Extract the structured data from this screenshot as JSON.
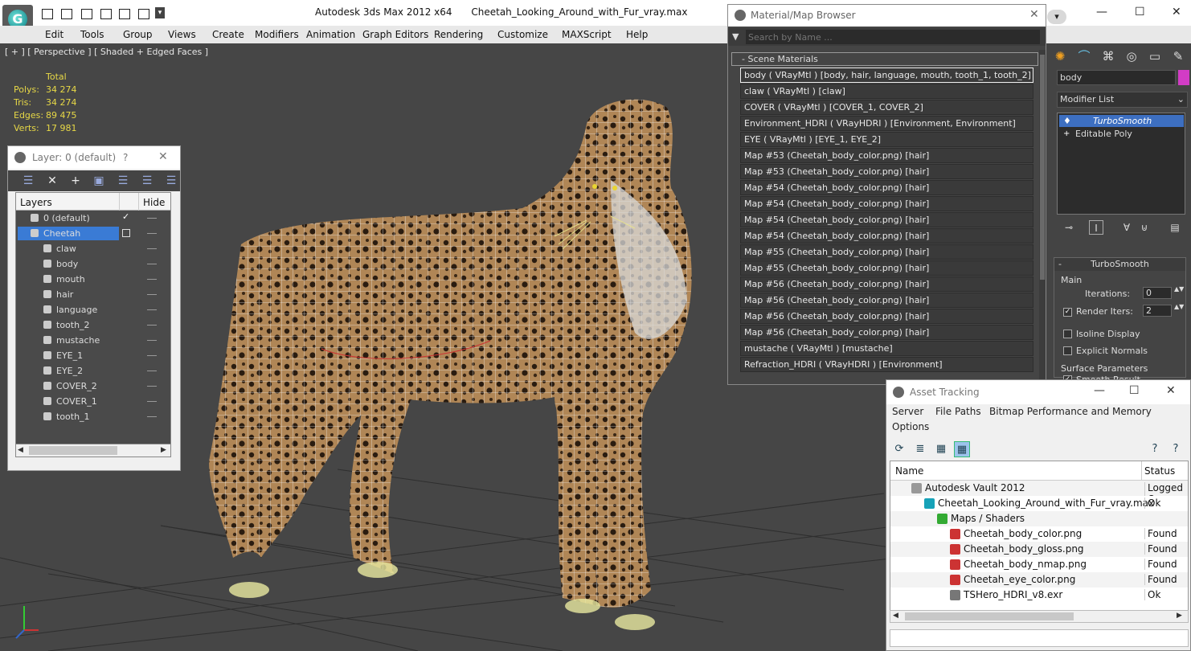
{
  "title_bar": {
    "app_title": "Autodesk 3ds Max  2012 x64",
    "file_name": "Cheetah_Looking_Around_with_Fur_vray.max"
  },
  "menu": [
    "Edit",
    "Tools",
    "Group",
    "Views",
    "Create",
    "Modifiers",
    "Animation",
    "Graph Editors",
    "Rendering",
    "Customize",
    "MAXScript",
    "Help"
  ],
  "viewport": {
    "label": "[ + ] [ Perspective ] [ Shaded + Edged Faces ]",
    "stats": {
      "header": "Total",
      "rows": [
        {
          "label": "Polys:",
          "value": "34 274"
        },
        {
          "label": "Tris:",
          "value": "34 274"
        },
        {
          "label": "Edges:",
          "value": "89 475"
        },
        {
          "label": "Verts:",
          "value": "17 981"
        }
      ]
    }
  },
  "layer_dialog": {
    "title": "Layer: 0 (default)",
    "help": "?",
    "columns": {
      "layers": "Layers",
      "hide": "Hide"
    },
    "rows": [
      {
        "name": "0 (default)",
        "level": 1,
        "current": true
      },
      {
        "name": "Cheetah",
        "level": 1,
        "selected": true
      },
      {
        "name": "claw",
        "level": 2
      },
      {
        "name": "body",
        "level": 2
      },
      {
        "name": "mouth",
        "level": 2
      },
      {
        "name": "hair",
        "level": 2
      },
      {
        "name": "language",
        "level": 2
      },
      {
        "name": "tooth_2",
        "level": 2
      },
      {
        "name": "mustache",
        "level": 2
      },
      {
        "name": "EYE_1",
        "level": 2
      },
      {
        "name": "EYE_2",
        "level": 2
      },
      {
        "name": "COVER_2",
        "level": 2
      },
      {
        "name": "COVER_1",
        "level": 2
      },
      {
        "name": "tooth_1",
        "level": 2
      }
    ]
  },
  "material_browser": {
    "title": "Material/Map Browser",
    "search_placeholder": "Search by Name ...",
    "section": "- Scene Materials",
    "items": [
      "body  ( VRayMtl )  [body, hair, language, mouth, tooth_1, tooth_2]",
      "claw  ( VRayMtl )  [claw]",
      "COVER  ( VRayMtl )  [COVER_1, COVER_2]",
      "Environment_HDRI  ( VRayHDRI )  [Environment, Environment]",
      "EYE  ( VRayMtl )  [EYE_1, EYE_2]",
      "Map #53 (Cheetah_body_color.png)  [hair]",
      "Map #53 (Cheetah_body_color.png)  [hair]",
      "Map #54 (Cheetah_body_color.png)  [hair]",
      "Map #54 (Cheetah_body_color.png)  [hair]",
      "Map #54 (Cheetah_body_color.png)  [hair]",
      "Map #54 (Cheetah_body_color.png)  [hair]",
      "Map #55 (Cheetah_body_color.png)  [hair]",
      "Map #55 (Cheetah_body_color.png)  [hair]",
      "Map #56 (Cheetah_body_color.png)  [hair]",
      "Map #56 (Cheetah_body_color.png)  [hair]",
      "Map #56 (Cheetah_body_color.png)  [hair]",
      "Map #56 (Cheetah_body_color.png)  [hair]",
      "mustache  ( VRayMtl )  [mustache]",
      "Refraction_HDRI  ( VRayHDRI )  [Environment]"
    ]
  },
  "command_panel": {
    "object_name": "body",
    "object_color": "#d23cc5",
    "modifier_list": "Modifier List",
    "stack": [
      {
        "name": "TurboSmooth",
        "selected": true
      },
      {
        "name": "Editable Poly",
        "selected": false
      }
    ],
    "turbosmooth": {
      "header": "TurboSmooth",
      "main": "Main",
      "iterations_label": "Iterations:",
      "iterations_value": "0",
      "render_iters_label": "Render Iters:",
      "render_iters_value": "2",
      "isoline": "Isoline Display",
      "explicit": "Explicit Normals",
      "surface": "Surface Parameters",
      "smooth_result": "Smooth Result"
    }
  },
  "asset_tracking": {
    "title": "Asset Tracking",
    "menu": [
      "Server",
      "File",
      "Paths",
      "Bitmap Performance and Memory",
      "Options"
    ],
    "columns": {
      "name": "Name",
      "status": "Status"
    },
    "rows": [
      {
        "name": "Autodesk Vault 2012",
        "status": "Logged O",
        "indent": 1,
        "icon": "vault-icon"
      },
      {
        "name": "Cheetah_Looking_Around_with_Fur_vray.max",
        "status": "Ok",
        "indent": 2,
        "icon": "max-file-icon"
      },
      {
        "name": "Maps / Shaders",
        "status": "",
        "indent": 3,
        "icon": "maps-icon"
      },
      {
        "name": "Cheetah_body_color.png",
        "status": "Found",
        "indent": 4,
        "icon": "png-icon"
      },
      {
        "name": "Cheetah_body_gloss.png",
        "status": "Found",
        "indent": 4,
        "icon": "png-icon"
      },
      {
        "name": "Cheetah_body_nmap.png",
        "status": "Found",
        "indent": 4,
        "icon": "png-icon"
      },
      {
        "name": "Cheetah_eye_color.png",
        "status": "Found",
        "indent": 4,
        "icon": "png-icon"
      },
      {
        "name": "TSHero_HDRI_v8.exr",
        "status": "Ok",
        "indent": 4,
        "icon": "exr-icon"
      }
    ]
  }
}
